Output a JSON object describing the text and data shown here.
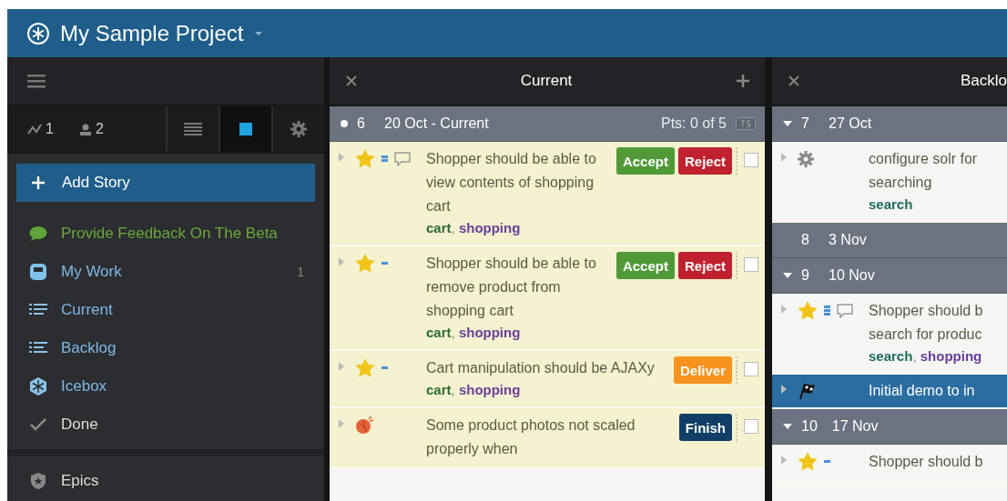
{
  "project": {
    "title": "My Sample Project"
  },
  "sidebar": {
    "stats": [
      {
        "kind": "velocity",
        "value": "1"
      },
      {
        "kind": "people",
        "value": "2"
      }
    ],
    "toolbar": [
      {
        "kind": "list",
        "selected": false
      },
      {
        "kind": "square",
        "selected": true
      },
      {
        "kind": "gear",
        "selected": false
      }
    ],
    "add_button": "Add Story",
    "items": [
      {
        "kind": "feedback",
        "label": "Provide Feedback On The Beta"
      },
      {
        "kind": "mywork",
        "label": "My Work",
        "count": "1"
      },
      {
        "kind": "current",
        "label": "Current"
      },
      {
        "kind": "backlog",
        "label": "Backlog"
      },
      {
        "kind": "icebox",
        "label": "Icebox"
      },
      {
        "kind": "done",
        "label": "Done"
      }
    ],
    "footer_items": [
      {
        "kind": "epics",
        "label": "Epics"
      }
    ]
  },
  "tag_separator": ", ",
  "panels": [
    {
      "title": "Current",
      "closable": true,
      "addable": true,
      "groups": [
        {
          "kind": "current",
          "number": "6",
          "date": "20 Oct - Current",
          "points": "Pts: 0 of 5",
          "stories": [
            {
              "kind": "feature",
              "estimate": {
                "kind": "two"
              },
              "comments": true,
              "started": true,
              "title": "Shopper should be able to view contents of shopping cart",
              "tags": [
                {
                  "label": "cart",
                  "color": "#2e6b3a"
                },
                {
                  "label": "shopping",
                  "color": "#6a3d9a"
                }
              ],
              "actions": [
                {
                  "kind": "accept",
                  "label": "Accept"
                },
                {
                  "kind": "reject",
                  "label": "Reject"
                }
              ],
              "checked": false
            },
            {
              "kind": "feature",
              "estimate": {
                "kind": "one"
              },
              "started": true,
              "title": "Shopper should be able to remove product from shopping cart",
              "tags": [
                {
                  "label": "cart",
                  "color": "#2e6b3a"
                },
                {
                  "label": "shopping",
                  "color": "#6a3d9a"
                }
              ],
              "actions": [
                {
                  "kind": "accept",
                  "label": "Accept"
                },
                {
                  "kind": "reject",
                  "label": "Reject"
                }
              ],
              "checked": false
            },
            {
              "kind": "feature",
              "estimate": {
                "kind": "one"
              },
              "started": true,
              "title": "Cart manipulation should be AJAXy",
              "tags": [
                {
                  "label": "cart",
                  "color": "#2e6b3a"
                },
                {
                  "label": "shopping",
                  "color": "#6a3d9a"
                }
              ],
              "actions": [
                {
                  "kind": "deliver",
                  "label": "Deliver"
                }
              ],
              "checked": false
            },
            {
              "kind": "bug",
              "started": true,
              "title": "Some product photos not scaled properly when",
              "actions": [
                {
                  "kind": "finish",
                  "label": "Finish"
                }
              ],
              "checked": false
            }
          ]
        }
      ]
    },
    {
      "title": "Backlo",
      "closable": true,
      "groups": [
        {
          "kind": "expanded",
          "number": "7",
          "date": "27 Oct",
          "stories": [
            {
              "kind": "chore",
              "started": false,
              "title": "configure solr for\nsearching",
              "tags": [
                {
                  "label": "search",
                  "color": "#1f6b5a"
                }
              ]
            }
          ]
        },
        {
          "kind": "empty",
          "number": "8",
          "date": "3 Nov"
        },
        {
          "kind": "expanded",
          "number": "9",
          "date": "10 Nov",
          "stories": [
            {
              "kind": "feature",
              "estimate": {
                "kind": "three"
              },
              "comments": true,
              "started": false,
              "title": "Shopper should b\nsearch for produc",
              "tags": [
                {
                  "label": "search",
                  "color": "#1f6b5a"
                },
                {
                  "label": "shopping",
                  "color": "#6a3d9a"
                }
              ]
            },
            {
              "kind": "release",
              "title": "Initial demo to in"
            }
          ]
        },
        {
          "kind": "expanded",
          "number": "10",
          "date": "17 Nov",
          "stories": [
            {
              "kind": "feature",
              "estimate": {
                "kind": "one"
              },
              "started": false,
              "title": "Shopper should b"
            }
          ]
        }
      ]
    }
  ]
}
